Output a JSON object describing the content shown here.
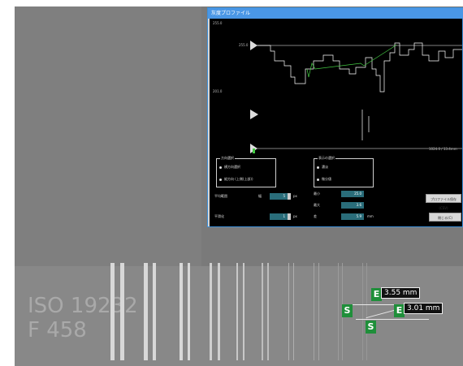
{
  "window": {
    "title": "灰度プロファイル"
  },
  "plot": {
    "left_labels": [
      "255.0",
      "255.0"
    ],
    "mid_labels": [
      "201.0"
    ],
    "bottom_right_label": "1024.0 / 13.4mm",
    "markers": [
      "threshold-top",
      "threshold-mid",
      "threshold-bottom"
    ]
  },
  "panel": {
    "group1": {
      "title": "方向選択",
      "options": [
        "横方向選択",
        "縦方向 (上側(上部))"
      ]
    },
    "group2": {
      "title": "表示の選択",
      "options": [
        "濃淡",
        "微分値"
      ]
    },
    "row1": {
      "label": "平均範囲",
      "sub": "幅",
      "value": "5",
      "unit": "px"
    },
    "row2": {
      "label": "平滑化",
      "value": "1",
      "unit": "px"
    },
    "stats": [
      {
        "label": "最小",
        "value": "25.0"
      },
      {
        "label": "最大",
        "value": "3.6"
      },
      {
        "label": "差",
        "value": "5.9",
        "unit": "mm"
      }
    ],
    "buttons": [
      "プロファイル保存(CSV)",
      "閉じる(C)"
    ]
  },
  "overlay": {
    "iqi_line1": "ISO 19232",
    "iqi_line2": "F 458",
    "marker_s": "S",
    "marker_e": "E",
    "measure1": "3.55 mm",
    "measure2": "3.01 mm"
  },
  "colors": {
    "accent": "#4a97e6",
    "marker": "#1f8f3a",
    "plot_line": "#ffffff",
    "plot_green": "#44cc44"
  }
}
